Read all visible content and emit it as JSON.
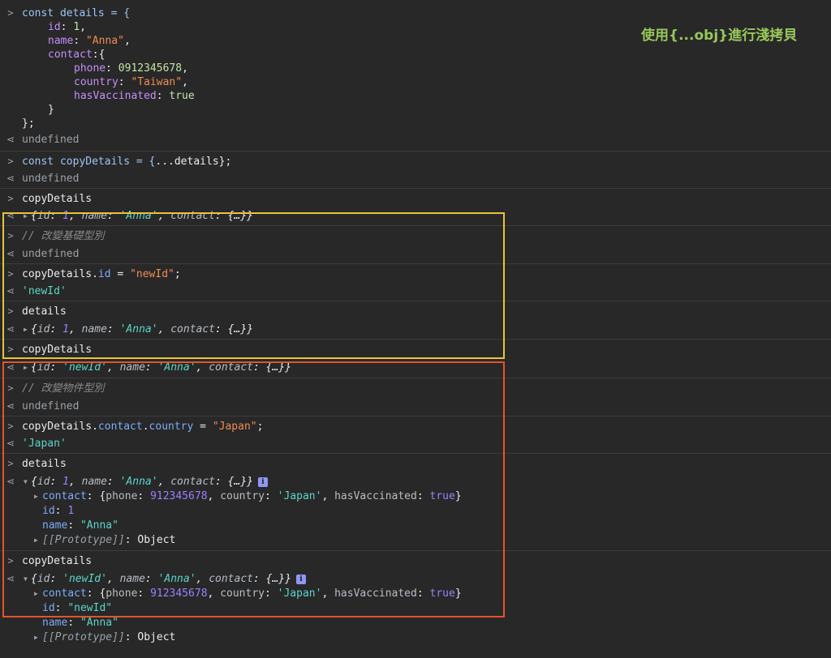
{
  "annotation": "使用{...obj}進行淺拷貝",
  "chevron_prompt": ">",
  "chevron_return": "⋖",
  "undefined": "undefined",
  "block1": {
    "l1": [
      "const",
      " details = {"
    ],
    "l2": [
      "id",
      ": ",
      "1",
      ","
    ],
    "l3": [
      "name",
      ": ",
      "\"Anna\"",
      ","
    ],
    "l4": [
      "contact",
      ":{"
    ],
    "l5": [
      "phone",
      ": ",
      "0912345678",
      ","
    ],
    "l6": [
      "country",
      ": ",
      "\"Taiwan\"",
      ","
    ],
    "l7": [
      "hasVaccinated",
      ": ",
      "true"
    ],
    "l8": "}",
    "l9": "};"
  },
  "block2": {
    "kw": "const",
    "rest1": " copyDetails = {",
    "dots": "...",
    "rest2": "details};"
  },
  "block3": {
    "input": "copyDetails",
    "out_open": "{",
    "k_id": "id",
    "v_id": "1",
    "k_name": "name",
    "v_name": "'Anna'",
    "k_contact": "contact",
    "v_contact": "{…}",
    "out_close": "}"
  },
  "block4": {
    "comment": "// 改變基礎型別"
  },
  "block5": {
    "input_pre": "copyDetails.",
    "input_prop": "id",
    "input_mid": " = ",
    "input_str": "\"newId\"",
    "input_end": ";",
    "result": "'newId'"
  },
  "block6": {
    "input": "details",
    "out_open": "{",
    "k_id": "id",
    "v_id": "1",
    "k_name": "name",
    "v_name": "'Anna'",
    "k_contact": "contact",
    "v_contact": "{…}",
    "out_close": "}"
  },
  "block7": {
    "input": "copyDetails",
    "out_open": "{",
    "k_id": "id",
    "v_id": "'newId'",
    "k_name": "name",
    "v_name": "'Anna'",
    "k_contact": "contact",
    "v_contact": "{…}",
    "out_close": "}"
  },
  "block8": {
    "comment": "// 改變物件型別"
  },
  "block9": {
    "input_pre": "copyDetails.",
    "input_prop1": "contact",
    "input_dot": ".",
    "input_prop2": "country",
    "input_mid": " = ",
    "input_str": "\"Japan\"",
    "input_end": ";",
    "result": "'Japan'"
  },
  "block10": {
    "input": "details",
    "out_open": "{",
    "k_id": "id",
    "v_id": "1",
    "k_name": "name",
    "v_name": "'Anna'",
    "k_contact": "contact",
    "v_contact": "{…}",
    "out_close": "}",
    "contact_key": "contact",
    "contact_open": "{",
    "phone_key": "phone",
    "phone_val": "912345678",
    "country_key": "country",
    "country_val": "'Japan'",
    "vacc_key": "hasVaccinated",
    "vacc_val": "true",
    "contact_close": "}",
    "id_key": "id",
    "id_val": "1",
    "name_key": "name",
    "name_val": "\"Anna\"",
    "proto_key": "[[Prototype]]",
    "proto_val": "Object"
  },
  "block11": {
    "input": "copyDetails",
    "out_open": "{",
    "k_id": "id",
    "v_id": "'newId'",
    "k_name": "name",
    "v_name": "'Anna'",
    "k_contact": "contact",
    "v_contact": "{…}",
    "out_close": "}",
    "contact_key": "contact",
    "contact_open": "{",
    "phone_key": "phone",
    "phone_val": "912345678",
    "country_key": "country",
    "country_val": "'Japan'",
    "vacc_key": "hasVaccinated",
    "vacc_val": "true",
    "contact_close": "}",
    "id_key": "id",
    "id_val": "\"newId\"",
    "name_key": "name",
    "name_val": "\"Anna\"",
    "proto_key": "[[Prototype]]",
    "proto_val": "Object"
  },
  "info_icon": "i",
  "colors": {
    "highlight_yellow": "#e8c33c",
    "highlight_red": "#e2542b",
    "annotation_green": "#98c75a"
  }
}
